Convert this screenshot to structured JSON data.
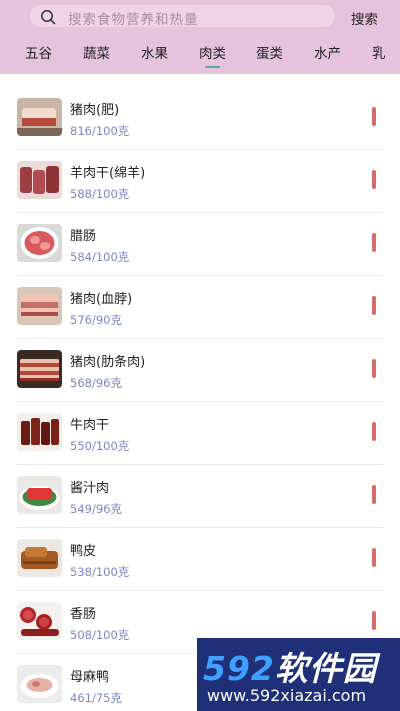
{
  "search": {
    "placeholder": "搜索食物营养和热量",
    "button_label": "搜索"
  },
  "tabs": [
    {
      "label": "五谷"
    },
    {
      "label": "蔬菜"
    },
    {
      "label": "水果"
    },
    {
      "label": "肉类",
      "selected": true
    },
    {
      "label": "蛋类"
    },
    {
      "label": "水产"
    },
    {
      "label": "乳"
    }
  ],
  "colors": {
    "header": "#e5c3dd",
    "calorie_text": "#7a86c8",
    "bar": "#d86a6a",
    "tab_indicator": "#5aa7a0"
  },
  "foods": [
    {
      "name": "猪肉(肥)",
      "calories": "816/100克",
      "image": "fatty-pork"
    },
    {
      "name": "羊肉干(绵羊)",
      "calories": "588/100克",
      "image": "dried-mutton"
    },
    {
      "name": "腊肠",
      "calories": "584/100克",
      "image": "chinese-sausage"
    },
    {
      "name": "猪肉(血脖)",
      "calories": "576/90克",
      "image": "pork-neck"
    },
    {
      "name": "猪肉(肋条肉)",
      "calories": "568/96克",
      "image": "pork-rib"
    },
    {
      "name": "牛肉干",
      "calories": "550/100克",
      "image": "beef-jerky"
    },
    {
      "name": "酱汁肉",
      "calories": "549/96克",
      "image": "sauce-meat"
    },
    {
      "name": "鸭皮",
      "calories": "538/100克",
      "image": "duck-skin"
    },
    {
      "name": "香肠",
      "calories": "508/100克",
      "image": "sausage"
    },
    {
      "name": "母麻鸭",
      "calories": "461/75克",
      "image": "duck-meat"
    }
  ],
  "watermark": {
    "logo_num": "592",
    "logo_cn": "软件园",
    "url": "www.592xiazai.com"
  }
}
